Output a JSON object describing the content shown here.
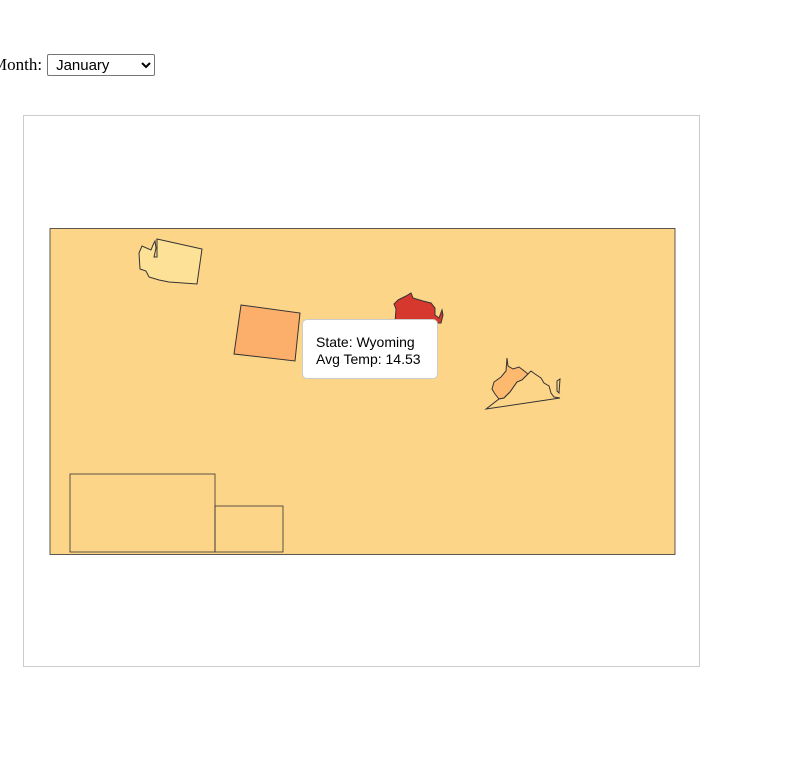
{
  "controls": {
    "month_label": "Month:",
    "month_selected": "January"
  },
  "map": {
    "background_fill": "#fdd589",
    "states": [
      {
        "name": "Washington",
        "fill": "#fde196"
      },
      {
        "name": "Wyoming",
        "fill": "#fcae6b"
      },
      {
        "name": "Wisconsin",
        "fill": "#d7382e"
      },
      {
        "name": "West Virginia",
        "fill": "#fdba6f"
      },
      {
        "name": "Virginia",
        "fill": "#fdd589"
      }
    ]
  },
  "tooltip": {
    "state_line": "State: Wyoming",
    "temp_line": "Avg Temp: 14.53"
  }
}
